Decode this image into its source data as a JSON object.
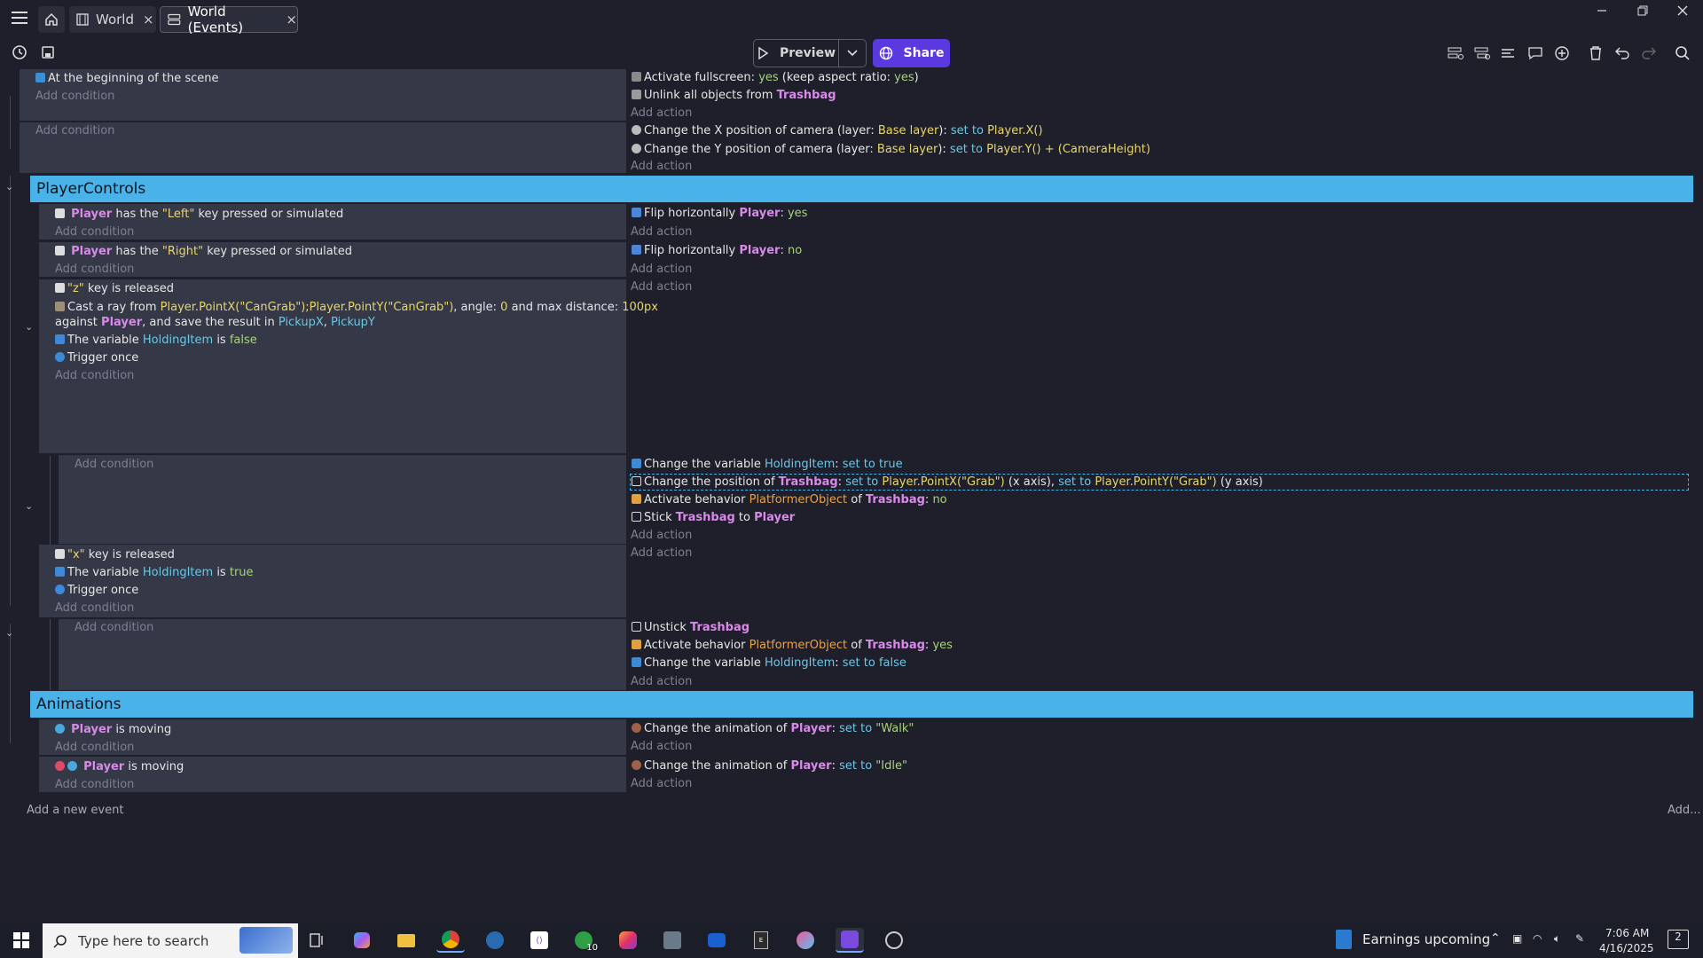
{
  "titlebar": {
    "tabs": [
      {
        "label": "World",
        "close": "×"
      },
      {
        "label": "World (Events)",
        "close": "×"
      }
    ]
  },
  "toolbar": {
    "preview_label": "Preview",
    "share_label": "Share"
  },
  "events": {
    "e1": {
      "cond": "At the beginning of the scene",
      "add_condition": "Add condition",
      "a1_prefix": "Activate fullscreen: ",
      "a1_yes1": "yes",
      "a1_mid": " (keep aspect ratio: ",
      "a1_yes2": "yes",
      "a1_end": ")",
      "a2_prefix": "Unlink all objects from ",
      "a2_obj": "Trashbag",
      "add_action": "Add action"
    },
    "e2": {
      "add_condition": "Add condition",
      "a1_prefix": "Change the X position of camera  (layer: ",
      "a1_layer": "Base layer",
      "a1_mid": "):  ",
      "a1_set": "set to",
      "a1_val": "Player.X()",
      "a2_prefix": "Change the Y position of camera  (layer: ",
      "a2_layer": "Base layer",
      "a2_mid": "):  ",
      "a2_set": "set to",
      "a2_val": "Player.Y() + (CameraHeight)",
      "add_action": "Add action"
    },
    "group1": "PlayerControls",
    "e3": {
      "obj": "Player",
      "text1": " has the ",
      "key": "\"Left\"",
      "text2": " key pressed or simulated",
      "add_condition": "Add condition",
      "a1": "Flip horizontally ",
      "a1_obj": "Player",
      "a1_colon": ": ",
      "a1_val": "yes",
      "add_action": "Add action"
    },
    "e4": {
      "obj": "Player",
      "text1": " has the ",
      "key": "\"Right\"",
      "text2": " key pressed or simulated",
      "add_condition": "Add condition",
      "a1": "Flip horizontally ",
      "a1_obj": "Player",
      "a1_colon": ": ",
      "a1_val": "no",
      "add_action": "Add action"
    },
    "e5": {
      "c1_key": "\"z\"",
      "c1_text": " key is released",
      "c2_a": "Cast a ray from ",
      "c2_v1": "Player.PointX(\"CanGrab\");Player.PointY(\"CanGrab\")",
      "c2_b": ", angle: ",
      "c2_v2": "0",
      "c2_c": " and max distance: ",
      "c2_v3": "100px",
      "c2_d": "against ",
      "c2_obj": "Player",
      "c2_e": ", and save the result in ",
      "c2_v4": "PickupX",
      "c2_f": ", ",
      "c2_v5": "PickupY",
      "c3_a": "The variable ",
      "c3_var": "HoldingItem",
      "c3_b": " is ",
      "c3_val": "false",
      "c4": "Trigger once",
      "add_condition": "Add condition",
      "add_action": "Add action"
    },
    "e5sub": {
      "add_condition": "Add condition",
      "a1_a": "Change the variable ",
      "a1_var": "HoldingItem",
      "a1_b": ": ",
      "a1_val": "set to true",
      "a2_a": "Change the position of ",
      "a2_obj": "Trashbag",
      "a2_b": ": ",
      "a2_set1": "set to",
      "a2_v1": "Player.PointX(\"Grab\")",
      "a2_c": " (x axis), ",
      "a2_set2": "set to",
      "a2_v2": "Player.PointY(\"Grab\")",
      "a2_d": " (y axis)",
      "a3_a": "Activate behavior ",
      "a3_beh": "PlatformerObject",
      "a3_b": " of ",
      "a3_obj": "Trashbag",
      "a3_c": ": ",
      "a3_val": "no",
      "a4_a": "Stick ",
      "a4_obj": "Trashbag",
      "a4_b": " to ",
      "a4_obj2": "Player",
      "add_action": "Add action"
    },
    "e6": {
      "c1_key": "\"x\"",
      "c1_text": " key is released",
      "c2_a": "The variable ",
      "c2_var": "HoldingItem",
      "c2_b": " is ",
      "c2_val": "true",
      "c3": "Trigger once",
      "add_condition": "Add condition",
      "add_action": "Add action"
    },
    "e6sub": {
      "add_condition": "Add condition",
      "a1_a": "Unstick ",
      "a1_obj": "Trashbag",
      "a2_a": "Activate behavior ",
      "a2_beh": "PlatformerObject",
      "a2_b": " of ",
      "a2_obj": "Trashbag",
      "a2_c": ": ",
      "a2_val": "yes",
      "a3_a": "Change the variable ",
      "a3_var": "HoldingItem",
      "a3_b": ": ",
      "a3_val": "set to false",
      "add_action": "Add action"
    },
    "group2": "Animations",
    "e7": {
      "obj": "Player",
      "text": " is moving",
      "add_condition": "Add condition",
      "a1_a": "Change the animation of ",
      "a1_obj": "Player",
      "a1_b": ": ",
      "a1_set": "set to",
      "a1_val": "\"Walk\"",
      "add_action": "Add action"
    },
    "e8": {
      "obj": "Player",
      "text": " is moving",
      "add_condition": "Add condition",
      "a1_a": "Change the animation of ",
      "a1_obj": "Player",
      "a1_b": ": ",
      "a1_set": "set to",
      "a1_val": "\"Idle\"",
      "add_action": "Add action"
    },
    "add_event": "Add a new event",
    "add_more": "Add..."
  },
  "taskbar": {
    "search_placeholder": "Type here to search",
    "news": "Earnings upcoming",
    "time": "7:06 AM",
    "date": "4/16/2025",
    "xbox_badge": "10",
    "notif_count": "2"
  },
  "colors": {
    "accent": "#49b2e8",
    "share": "#5a3ae0",
    "object": "#d88ae8",
    "value": "#e8d66b"
  }
}
